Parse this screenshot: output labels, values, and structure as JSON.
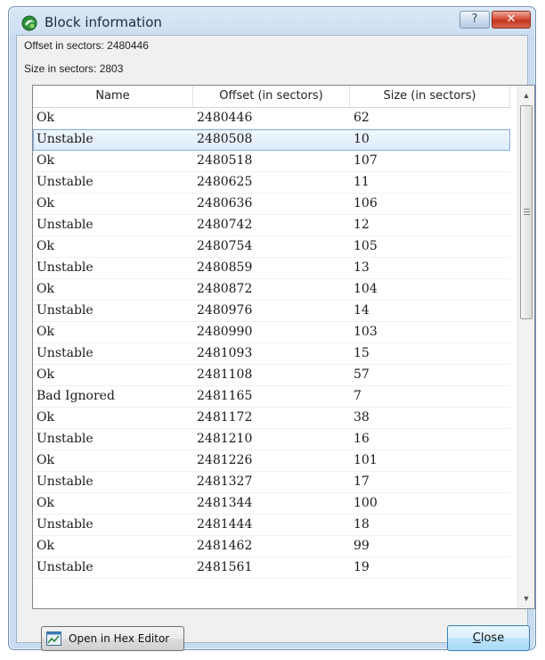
{
  "window": {
    "title": "Block information",
    "help_glyph": "?",
    "close_glyph": "✕"
  },
  "info": {
    "offset_line": "Offset in sectors: 2480446",
    "size_line": "Size in sectors: 2803"
  },
  "table": {
    "columns": [
      "Name",
      "Offset (in sectors)",
      "Size (in sectors)"
    ],
    "selected_row": 1,
    "rows": [
      {
        "name": "Ok",
        "offset": "2480446",
        "size": "62"
      },
      {
        "name": "Unstable",
        "offset": "2480508",
        "size": "10"
      },
      {
        "name": "Ok",
        "offset": "2480518",
        "size": "107"
      },
      {
        "name": "Unstable",
        "offset": "2480625",
        "size": "11"
      },
      {
        "name": "Ok",
        "offset": "2480636",
        "size": "106"
      },
      {
        "name": "Unstable",
        "offset": "2480742",
        "size": "12"
      },
      {
        "name": "Ok",
        "offset": "2480754",
        "size": "105"
      },
      {
        "name": "Unstable",
        "offset": "2480859",
        "size": "13"
      },
      {
        "name": "Ok",
        "offset": "2480872",
        "size": "104"
      },
      {
        "name": "Unstable",
        "offset": "2480976",
        "size": "14"
      },
      {
        "name": "Ok",
        "offset": "2480990",
        "size": "103"
      },
      {
        "name": "Unstable",
        "offset": "2481093",
        "size": "15"
      },
      {
        "name": "Ok",
        "offset": "2481108",
        "size": "57"
      },
      {
        "name": "Bad Ignored",
        "offset": "2481165",
        "size": "7"
      },
      {
        "name": "Ok",
        "offset": "2481172",
        "size": "38"
      },
      {
        "name": "Unstable",
        "offset": "2481210",
        "size": "16"
      },
      {
        "name": "Ok",
        "offset": "2481226",
        "size": "101"
      },
      {
        "name": "Unstable",
        "offset": "2481327",
        "size": "17"
      },
      {
        "name": "Ok",
        "offset": "2481344",
        "size": "100"
      },
      {
        "name": "Unstable",
        "offset": "2481444",
        "size": "18"
      },
      {
        "name": "Ok",
        "offset": "2481462",
        "size": "99"
      },
      {
        "name": "Unstable",
        "offset": "2481561",
        "size": "19"
      }
    ]
  },
  "scrollbar": {
    "up_glyph": "▲",
    "down_glyph": "▼"
  },
  "buttons": {
    "hex_editor_label": "Open in Hex Editor",
    "close_label": "Close"
  },
  "colors": {
    "title_bar": "#dbe9f6",
    "close_button": "#c2361f",
    "selection": "#dcebfc",
    "default_button_border": "#3c7fb1"
  },
  "icons": {
    "title": "app-logo-icon",
    "hex_button": "hex-editor-icon"
  }
}
